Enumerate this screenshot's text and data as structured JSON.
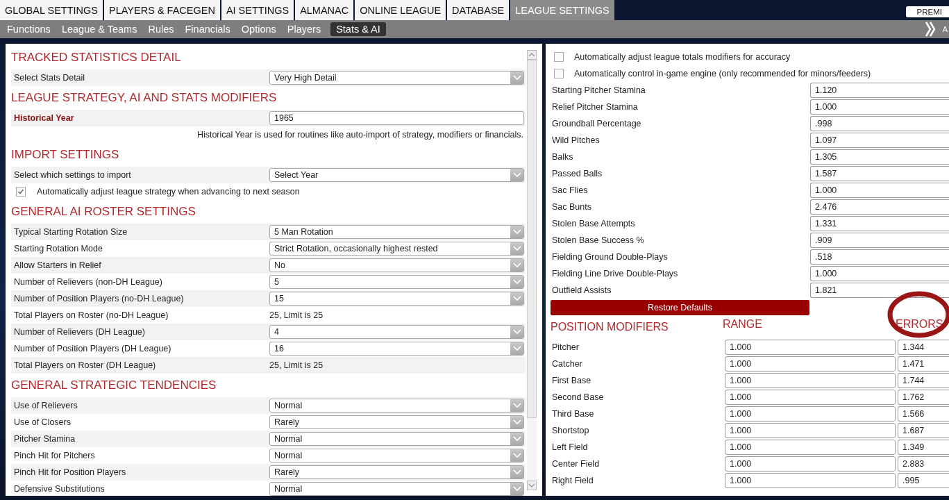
{
  "top_tabs": [
    {
      "label": "GLOBAL SETTINGS",
      "selected": false
    },
    {
      "label": "PLAYERS & FACEGEN",
      "selected": false
    },
    {
      "label": "AI SETTINGS",
      "selected": false
    },
    {
      "label": "ALMANAC",
      "selected": false
    },
    {
      "label": "ONLINE LEAGUE",
      "selected": false
    },
    {
      "label": "DATABASE",
      "selected": false
    },
    {
      "label": "LEAGUE SETTINGS",
      "selected": true
    }
  ],
  "premium_button": "PREMI",
  "sub_tabs": [
    {
      "label": "Functions",
      "selected": false
    },
    {
      "label": "League & Teams",
      "selected": false
    },
    {
      "label": "Rules",
      "selected": false
    },
    {
      "label": "Financials",
      "selected": false
    },
    {
      "label": "Options",
      "selected": false
    },
    {
      "label": "Players",
      "selected": false
    },
    {
      "label": "Stats & AI",
      "selected": true
    }
  ],
  "sub_bar_edge_text": "A",
  "left_sections": [
    {
      "title": "TRACKED STATISTICS DETAIL",
      "rows": [
        {
          "kind": "select",
          "label": "Select Stats Detail",
          "value": "Very High Detail"
        }
      ]
    },
    {
      "title": "LEAGUE STRATEGY, AI AND STATS MODIFIERS",
      "rows": [
        {
          "kind": "key_input",
          "label": "Historical Year",
          "value": "1965"
        },
        {
          "kind": "note",
          "label": "Historical Year is used for routines like auto-import of strategy, modifiers or financials."
        }
      ]
    },
    {
      "title": "IMPORT SETTINGS",
      "rows": [
        {
          "kind": "select",
          "label": "Select which settings to import",
          "value": "Select Year"
        },
        {
          "kind": "checkbox",
          "label": "Automatically adjust league strategy when advancing to next season",
          "checked": true
        }
      ]
    },
    {
      "title": "GENERAL AI ROSTER SETTINGS",
      "rows": [
        {
          "kind": "select",
          "label": "Typical Starting Rotation Size",
          "value": "5 Man Rotation"
        },
        {
          "kind": "select",
          "label": "Starting Rotation Mode",
          "value": "Strict Rotation, occasionally highest rested"
        },
        {
          "kind": "select",
          "label": "Allow Starters in Relief",
          "value": "No"
        },
        {
          "kind": "select",
          "label": "Number of Relievers (non-DH League)",
          "value": "5"
        },
        {
          "kind": "select",
          "label": "Number of Position Players (no-DH League)",
          "value": "15"
        },
        {
          "kind": "text",
          "label": "Total Players on Roster (no-DH League)",
          "value": "25, Limit is 25"
        },
        {
          "kind": "select",
          "label": "Number of Relievers (DH League)",
          "value": "4"
        },
        {
          "kind": "select",
          "label": "Number of Position Players (DH League)",
          "value": "16"
        },
        {
          "kind": "text",
          "label": "Total Players on Roster (DH League)",
          "value": "25, Limit is 25"
        }
      ]
    },
    {
      "title": "GENERAL STRATEGIC TENDENCIES",
      "rows": [
        {
          "kind": "select",
          "label": "Use of Relievers",
          "value": "Normal"
        },
        {
          "kind": "select",
          "label": "Use of Closers",
          "value": "Rarely"
        },
        {
          "kind": "select",
          "label": "Pitcher Stamina",
          "value": "Normal"
        },
        {
          "kind": "select",
          "label": "Pinch Hit for Pitchers",
          "value": "Normal"
        },
        {
          "kind": "select",
          "label": "Pinch Hit for Position Players",
          "value": "Rarely"
        },
        {
          "kind": "select",
          "label": "Defensive Substitutions",
          "value": "Normal"
        }
      ]
    }
  ],
  "right_checkboxes": [
    {
      "label": "Automatically adjust league totals modifiers for accuracy",
      "checked": false
    },
    {
      "label": "Automatically control in-game engine (only recommended for minors/feeders)",
      "checked": false
    }
  ],
  "modifiers": [
    {
      "label": "Starting Pitcher Stamina",
      "value": "1.120"
    },
    {
      "label": "Relief Pitcher Stamina",
      "value": "1.000"
    },
    {
      "label": "Groundball Percentage",
      "value": ".998"
    },
    {
      "label": "Wild Pitches",
      "value": "1.097"
    },
    {
      "label": "Balks",
      "value": "1.305"
    },
    {
      "label": "Passed Balls",
      "value": "1.587"
    },
    {
      "label": "Sac Flies",
      "value": "1.000"
    },
    {
      "label": "Sac Bunts",
      "value": "2.476"
    },
    {
      "label": "Stolen Base Attempts",
      "value": "1.331"
    },
    {
      "label": "Stolen Base Success %",
      "value": ".909"
    },
    {
      "label": "Fielding Ground Double-Plays",
      "value": ".518"
    },
    {
      "label": "Fielding Line Drive Double-Plays",
      "value": "1.000"
    },
    {
      "label": "Outfield Assists",
      "value": "1.821"
    }
  ],
  "restore_button": "Restore Defaults",
  "position_modifiers": {
    "title": "POSITION MODIFIERS",
    "range_heading": "RANGE",
    "errors_heading": "ERRORS",
    "rows": [
      {
        "label": "Pitcher",
        "range": "1.000",
        "errors": "1.344"
      },
      {
        "label": "Catcher",
        "range": "1.000",
        "errors": "1.471"
      },
      {
        "label": "First Base",
        "range": "1.000",
        "errors": "1.744"
      },
      {
        "label": "Second Base",
        "range": "1.000",
        "errors": "1.762"
      },
      {
        "label": "Third Base",
        "range": "1.000",
        "errors": "1.566"
      },
      {
        "label": "Shortstop",
        "range": "1.000",
        "errors": "1.687"
      },
      {
        "label": "Left Field",
        "range": "1.000",
        "errors": "1.349"
      },
      {
        "label": "Center Field",
        "range": "1.000",
        "errors": "2.883"
      },
      {
        "label": "Right Field",
        "range": "1.000",
        "errors": ".995"
      }
    ]
  }
}
